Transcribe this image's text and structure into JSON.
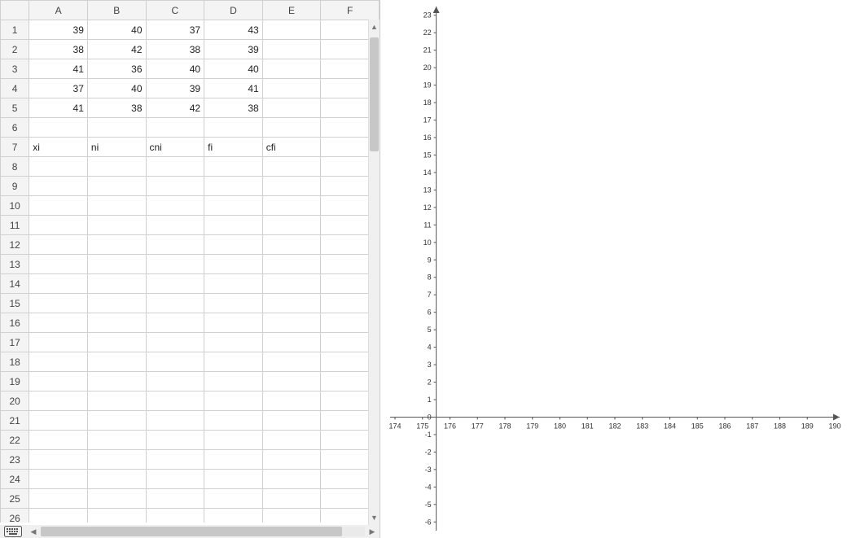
{
  "spreadsheet": {
    "columns": [
      "A",
      "B",
      "C",
      "D",
      "E",
      "F"
    ],
    "row_count": 26,
    "cells": {
      "r1": {
        "A": "39",
        "B": "40",
        "C": "37",
        "D": "43"
      },
      "r2": {
        "A": "38",
        "B": "42",
        "C": "38",
        "D": "39"
      },
      "r3": {
        "A": "41",
        "B": "36",
        "C": "40",
        "D": "40"
      },
      "r4": {
        "A": "37",
        "B": "40",
        "C": "39",
        "D": "41"
      },
      "r5": {
        "A": "41",
        "B": "38",
        "C": "42",
        "D": "38"
      },
      "r7": {
        "A": "xi",
        "B": "ni",
        "C": "cni",
        "D": "fi",
        "E": "cfi"
      }
    }
  },
  "chart_data": {
    "type": "scatter",
    "title": "",
    "xlabel": "",
    "ylabel": "",
    "x_ticks": [
      174,
      175,
      176,
      177,
      178,
      179,
      180,
      181,
      182,
      183,
      184,
      185,
      186,
      187,
      188,
      189,
      190
    ],
    "y_ticks": [
      -6,
      -5,
      -4,
      -3,
      -2,
      -1,
      0,
      1,
      2,
      3,
      4,
      5,
      6,
      7,
      8,
      9,
      10,
      11,
      12,
      13,
      14,
      15,
      16,
      17,
      18,
      19,
      20,
      21,
      22,
      23
    ],
    "x_origin": 175.5,
    "series": []
  }
}
